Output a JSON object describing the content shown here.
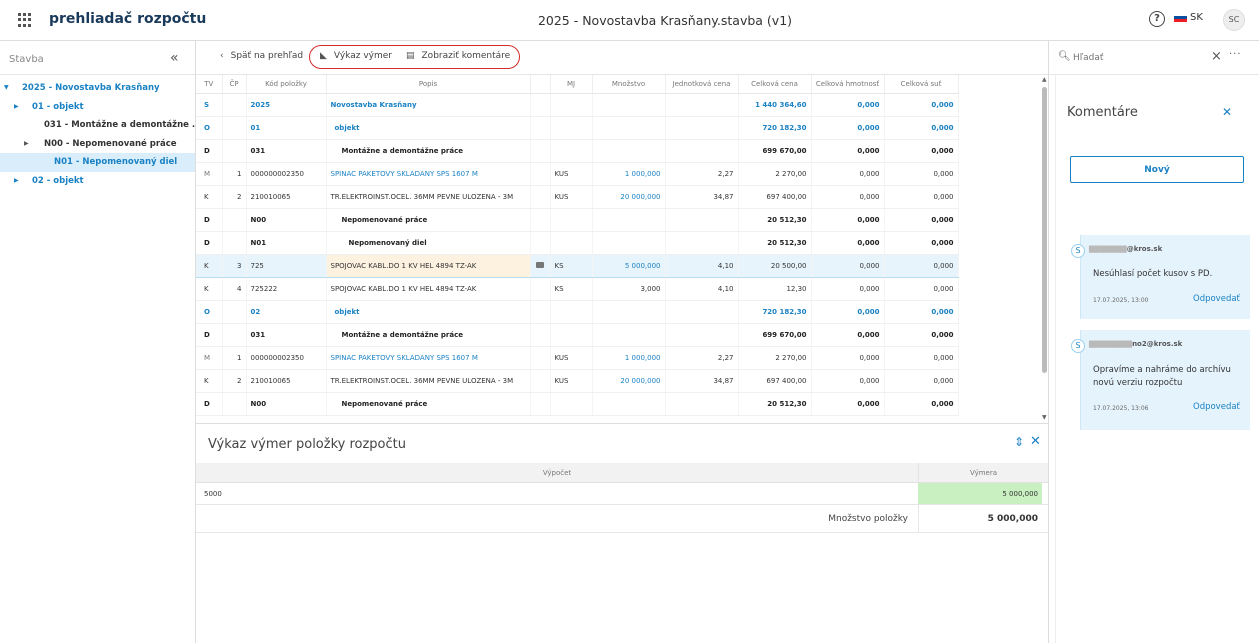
{
  "header": {
    "app_name": "prehliadač rozpočtu",
    "doc_title": "2025 - Novostavba Krasňany.stavba (v1)",
    "help_label": "?",
    "lang": "SK",
    "avatar": "SC"
  },
  "sidebar": {
    "title": "Stavba",
    "collapse": "«",
    "tree": [
      {
        "label": "2025 - Novostavba Krasňany",
        "caret": "▼",
        "style": "blue"
      },
      {
        "label": "01 - objekt",
        "caret": "▶",
        "style": "blue"
      },
      {
        "label": "031 - Montážne a demontážne ...",
        "caret": "",
        "style": "dark"
      },
      {
        "label": "N00 - Nepomenované práce",
        "caret": "▶",
        "style": "dark"
      },
      {
        "label": "N01 - Nepomenovaný diel",
        "caret": "",
        "style": "blue"
      },
      {
        "label": "02 - objekt",
        "caret": "▶",
        "style": "blue"
      }
    ]
  },
  "toolbar": {
    "back": "Späť na prehľad",
    "vykaz": "Výkaz výmer",
    "komentare": "Zobraziť komentáre"
  },
  "grid": {
    "columns": [
      "TV",
      "ČP",
      "Kód položky",
      "Popis",
      "",
      "MJ",
      "Množstvo",
      "Jednotková cena",
      "Celková cena",
      "Celková hmotnosť",
      "Celková suť"
    ],
    "rows": [
      {
        "tv": "S",
        "cp": "",
        "kod": "2025",
        "popis": "Novostavba Krasňany",
        "mj": "",
        "mn": "",
        "jc": "",
        "cc": "1 440 364,60",
        "hm": "0,000",
        "sut": "0,000",
        "type": "blue-bold"
      },
      {
        "tv": "O",
        "cp": "",
        "kod": "01",
        "popis": "objekt",
        "mj": "",
        "mn": "",
        "jc": "",
        "cc": "720 182,30",
        "hm": "0,000",
        "sut": "0,000",
        "type": "blue-bold"
      },
      {
        "tv": "D",
        "cp": "",
        "kod": "031",
        "popis": "Montážne a demontážne práce",
        "mj": "",
        "mn": "",
        "jc": "",
        "cc": "699 670,00",
        "hm": "0,000",
        "sut": "0,000",
        "type": "bold"
      },
      {
        "tv": "M",
        "cp": "1",
        "kod": "000000002350",
        "popis": "SPINAC PAKETOVY SKLADANY SPS 1607 M",
        "mj": "KUS",
        "mn": "1 000,000",
        "jc": "2,27",
        "cc": "2 270,00",
        "hm": "0,000",
        "sut": "0,000",
        "type": "m"
      },
      {
        "tv": "K",
        "cp": "2",
        "kod": "210010065",
        "popis": "TR.ELEKTROINST.OCEL. 36MM PEVNE ULOZENA - 3M",
        "mj": "KUS",
        "mn": "20 000,000",
        "jc": "34,87",
        "cc": "697 400,00",
        "hm": "0,000",
        "sut": "0,000",
        "type": "k-link"
      },
      {
        "tv": "D",
        "cp": "",
        "kod": "N00",
        "popis": "Nepomenované práce",
        "mj": "",
        "mn": "",
        "jc": "",
        "cc": "20 512,30",
        "hm": "0,000",
        "sut": "0,000",
        "type": "bold"
      },
      {
        "tv": "D",
        "cp": "",
        "kod": "N01",
        "popis": "Nepomenovaný diel",
        "mj": "",
        "mn": "",
        "jc": "",
        "cc": "20 512,30",
        "hm": "0,000",
        "sut": "0,000",
        "type": "bold2"
      },
      {
        "tv": "K",
        "cp": "3",
        "kod": "725",
        "popis": "SPOJOVAC KABL.DO 1 KV HEL 4894 TZ-AK",
        "mj": "KS",
        "mn": "5 000,000",
        "jc": "4,10",
        "cc": "20 500,00",
        "hm": "0,000",
        "sut": "0,000",
        "type": "sel"
      },
      {
        "tv": "K",
        "cp": "4",
        "kod": "725222",
        "popis": "SPOJOVAC KABL.DO 1 KV HEL 4894 TZ-AK",
        "mj": "KS",
        "mn": "3,000",
        "jc": "4,10",
        "cc": "12,30",
        "hm": "0,000",
        "sut": "0,000",
        "type": "plain"
      },
      {
        "tv": "O",
        "cp": "",
        "kod": "02",
        "popis": "objekt",
        "mj": "",
        "mn": "",
        "jc": "",
        "cc": "720 182,30",
        "hm": "0,000",
        "sut": "0,000",
        "type": "blue-bold"
      },
      {
        "tv": "D",
        "cp": "",
        "kod": "031",
        "popis": "Montážne a demontážne práce",
        "mj": "",
        "mn": "",
        "jc": "",
        "cc": "699 670,00",
        "hm": "0,000",
        "sut": "0,000",
        "type": "bold"
      },
      {
        "tv": "M",
        "cp": "1",
        "kod": "000000002350",
        "popis": "SPINAC PAKETOVY SKLADANY SPS 1607 M",
        "mj": "KUS",
        "mn": "1 000,000",
        "jc": "2,27",
        "cc": "2 270,00",
        "hm": "0,000",
        "sut": "0,000",
        "type": "m"
      },
      {
        "tv": "K",
        "cp": "2",
        "kod": "210010065",
        "popis": "TR.ELEKTROINST.OCEL. 36MM PEVNE ULOZENA - 3M",
        "mj": "KUS",
        "mn": "20 000,000",
        "jc": "34,87",
        "cc": "697 400,00",
        "hm": "0,000",
        "sut": "0,000",
        "type": "k-link"
      },
      {
        "tv": "D",
        "cp": "",
        "kod": "N00",
        "popis": "Nepomenované práce",
        "mj": "",
        "mn": "",
        "jc": "",
        "cc": "20 512,30",
        "hm": "0,000",
        "sut": "0,000",
        "type": "bold"
      }
    ]
  },
  "vykaz": {
    "title": "Výkaz výmer položky rozpočtu",
    "col_vypocet": "Výpočet",
    "col_vymera": "Výmera",
    "row_vypocet": "5000",
    "row_vymera": "5 000,000",
    "sum_label": "Množstvo položky",
    "sum_value": "5 000,000"
  },
  "search": {
    "placeholder": "Hľadať",
    "more": "···"
  },
  "comments": {
    "title": "Komentáre",
    "new_button": "Nový",
    "items": [
      {
        "badge": "S",
        "email": "@kros.sk",
        "text": "Nesúhlasí počet kusov s PD.",
        "time": "17.07.2025, 13:00",
        "reply": "Odpovedať"
      },
      {
        "badge": "S",
        "email": "no2@kros.sk",
        "text": "Opravíme a nahráme do archívu novú verziu rozpočtu",
        "time": "17.07.2025, 13:06",
        "reply": "Odpovedať"
      }
    ]
  },
  "colors": {
    "accent": "#1a82c4",
    "highlight": "#d42a2a",
    "selected_row": "#e8f4fb",
    "green_cell": "#c8f0c0"
  }
}
